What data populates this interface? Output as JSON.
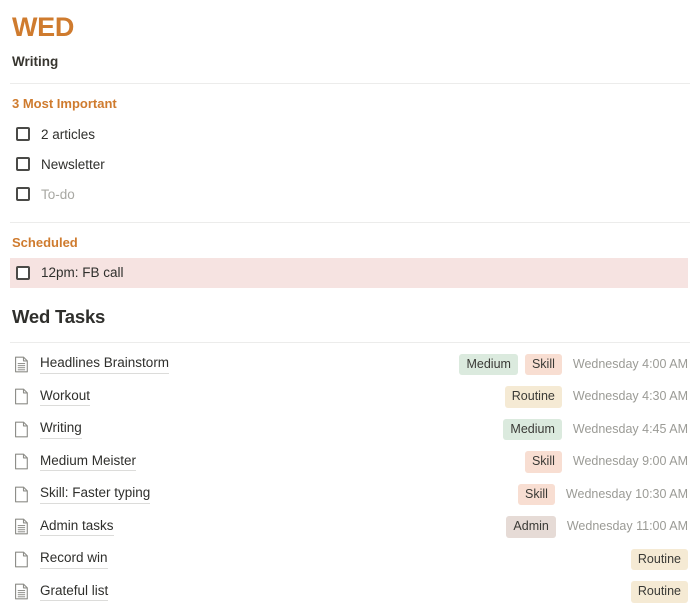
{
  "header": {
    "day_title": "WED",
    "subtitle": "Writing"
  },
  "most_important": {
    "section_label": "3 Most Important",
    "items": [
      {
        "label": "2 articles",
        "checked": false,
        "muted": false
      },
      {
        "label": "Newsletter",
        "checked": false,
        "muted": false
      },
      {
        "label": "To-do",
        "checked": false,
        "muted": true
      }
    ]
  },
  "scheduled": {
    "section_label": "Scheduled",
    "items": [
      {
        "label": "12pm: FB call",
        "checked": false,
        "highlighted": true
      }
    ]
  },
  "tasks": {
    "heading": "Wed Tasks",
    "rows": [
      {
        "icon": "document-lined-icon",
        "name": "Headlines Brainstorm",
        "tags": [
          "Medium",
          "Skill"
        ],
        "timestamp": "Wednesday 4:00 AM"
      },
      {
        "icon": "document-blank-icon",
        "name": "Workout",
        "tags": [
          "Routine"
        ],
        "timestamp": "Wednesday 4:30 AM"
      },
      {
        "icon": "document-blank-icon",
        "name": "Writing",
        "tags": [
          "Medium"
        ],
        "timestamp": "Wednesday 4:45 AM"
      },
      {
        "icon": "document-blank-icon",
        "name": "Medium Meister",
        "tags": [
          "Skill"
        ],
        "timestamp": "Wednesday 9:00 AM"
      },
      {
        "icon": "document-blank-icon",
        "name": "Skill: Faster typing",
        "tags": [
          "Skill"
        ],
        "timestamp": "Wednesday 10:30 AM"
      },
      {
        "icon": "document-lined-icon",
        "name": "Admin tasks",
        "tags": [
          "Admin"
        ],
        "timestamp": "Wednesday 11:00 AM"
      },
      {
        "icon": "document-blank-icon",
        "name": "Record win",
        "tags": [
          "Routine"
        ],
        "timestamp": ""
      },
      {
        "icon": "document-lined-icon",
        "name": "Grateful list",
        "tags": [
          "Routine"
        ],
        "timestamp": ""
      }
    ]
  },
  "colors": {
    "accent_orange": "#cf7b2e",
    "highlight_pink": "#f6e3e1",
    "tag_medium": "#dbeade",
    "tag_skill": "#f8ded2",
    "tag_routine": "#f5ead4",
    "tag_admin": "#e6dbd6",
    "text_primary": "#2f2f2c",
    "text_muted": "#9b9b96",
    "divider": "#ececeb"
  }
}
